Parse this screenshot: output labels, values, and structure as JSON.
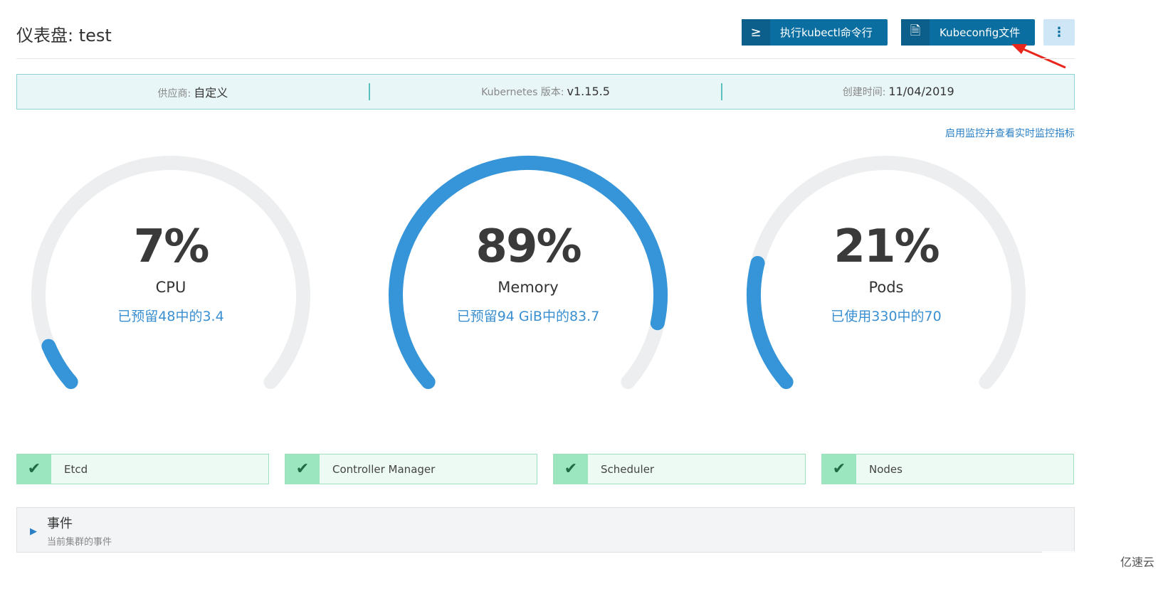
{
  "header": {
    "title": "仪表盘: test",
    "kubectl_button": "执行kubectl命令行",
    "kubectl_icon": "terminal-icon",
    "kubeconfig_button": "Kubeconfig文件",
    "kubeconfig_icon": "file-icon",
    "more_icon": "vertical-ellipsis-icon"
  },
  "info": {
    "provider_label": "供应商:",
    "provider_value": "自定义",
    "version_label": "Kubernetes 版本:",
    "version_value": "v1.15.5",
    "created_label": "创建时间:",
    "created_value": "11/04/2019"
  },
  "monitor_link": "启用监控并查看实时监控指标",
  "gauges": [
    {
      "percent_text": "7%",
      "name": "CPU",
      "detail": "已预留48中的3.4",
      "fraction": 0.07
    },
    {
      "percent_text": "89%",
      "name": "Memory",
      "detail": "已预留94 GiB中的83.7",
      "fraction": 0.89
    },
    {
      "percent_text": "21%",
      "name": "Pods",
      "detail": "已使用330中的70",
      "fraction": 0.21
    }
  ],
  "statuses": [
    {
      "label": "Etcd"
    },
    {
      "label": "Controller Manager"
    },
    {
      "label": "Scheduler"
    },
    {
      "label": "Nodes"
    }
  ],
  "events": {
    "title": "事件",
    "subtitle": "当前集群的事件"
  },
  "watermark": "亿速云",
  "colors": {
    "primary": "#0a6fa0",
    "gauge_fill": "#3595d8",
    "gauge_track": "#eceeef",
    "ok": "#9be5bf"
  }
}
